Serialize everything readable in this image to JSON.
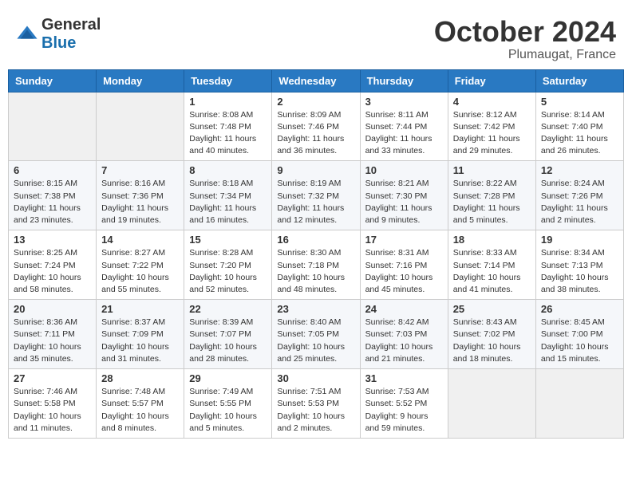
{
  "header": {
    "logo": {
      "general": "General",
      "blue": "Blue"
    },
    "title": "October 2024",
    "location": "Plumaugat, France"
  },
  "days_of_week": [
    "Sunday",
    "Monday",
    "Tuesday",
    "Wednesday",
    "Thursday",
    "Friday",
    "Saturday"
  ],
  "weeks": [
    [
      {
        "day": "",
        "sunrise": "",
        "sunset": "",
        "daylight": ""
      },
      {
        "day": "",
        "sunrise": "",
        "sunset": "",
        "daylight": ""
      },
      {
        "day": "1",
        "sunrise": "Sunrise: 8:08 AM",
        "sunset": "Sunset: 7:48 PM",
        "daylight": "Daylight: 11 hours and 40 minutes."
      },
      {
        "day": "2",
        "sunrise": "Sunrise: 8:09 AM",
        "sunset": "Sunset: 7:46 PM",
        "daylight": "Daylight: 11 hours and 36 minutes."
      },
      {
        "day": "3",
        "sunrise": "Sunrise: 8:11 AM",
        "sunset": "Sunset: 7:44 PM",
        "daylight": "Daylight: 11 hours and 33 minutes."
      },
      {
        "day": "4",
        "sunrise": "Sunrise: 8:12 AM",
        "sunset": "Sunset: 7:42 PM",
        "daylight": "Daylight: 11 hours and 29 minutes."
      },
      {
        "day": "5",
        "sunrise": "Sunrise: 8:14 AM",
        "sunset": "Sunset: 7:40 PM",
        "daylight": "Daylight: 11 hours and 26 minutes."
      }
    ],
    [
      {
        "day": "6",
        "sunrise": "Sunrise: 8:15 AM",
        "sunset": "Sunset: 7:38 PM",
        "daylight": "Daylight: 11 hours and 23 minutes."
      },
      {
        "day": "7",
        "sunrise": "Sunrise: 8:16 AM",
        "sunset": "Sunset: 7:36 PM",
        "daylight": "Daylight: 11 hours and 19 minutes."
      },
      {
        "day": "8",
        "sunrise": "Sunrise: 8:18 AM",
        "sunset": "Sunset: 7:34 PM",
        "daylight": "Daylight: 11 hours and 16 minutes."
      },
      {
        "day": "9",
        "sunrise": "Sunrise: 8:19 AM",
        "sunset": "Sunset: 7:32 PM",
        "daylight": "Daylight: 11 hours and 12 minutes."
      },
      {
        "day": "10",
        "sunrise": "Sunrise: 8:21 AM",
        "sunset": "Sunset: 7:30 PM",
        "daylight": "Daylight: 11 hours and 9 minutes."
      },
      {
        "day": "11",
        "sunrise": "Sunrise: 8:22 AM",
        "sunset": "Sunset: 7:28 PM",
        "daylight": "Daylight: 11 hours and 5 minutes."
      },
      {
        "day": "12",
        "sunrise": "Sunrise: 8:24 AM",
        "sunset": "Sunset: 7:26 PM",
        "daylight": "Daylight: 11 hours and 2 minutes."
      }
    ],
    [
      {
        "day": "13",
        "sunrise": "Sunrise: 8:25 AM",
        "sunset": "Sunset: 7:24 PM",
        "daylight": "Daylight: 10 hours and 58 minutes."
      },
      {
        "day": "14",
        "sunrise": "Sunrise: 8:27 AM",
        "sunset": "Sunset: 7:22 PM",
        "daylight": "Daylight: 10 hours and 55 minutes."
      },
      {
        "day": "15",
        "sunrise": "Sunrise: 8:28 AM",
        "sunset": "Sunset: 7:20 PM",
        "daylight": "Daylight: 10 hours and 52 minutes."
      },
      {
        "day": "16",
        "sunrise": "Sunrise: 8:30 AM",
        "sunset": "Sunset: 7:18 PM",
        "daylight": "Daylight: 10 hours and 48 minutes."
      },
      {
        "day": "17",
        "sunrise": "Sunrise: 8:31 AM",
        "sunset": "Sunset: 7:16 PM",
        "daylight": "Daylight: 10 hours and 45 minutes."
      },
      {
        "day": "18",
        "sunrise": "Sunrise: 8:33 AM",
        "sunset": "Sunset: 7:14 PM",
        "daylight": "Daylight: 10 hours and 41 minutes."
      },
      {
        "day": "19",
        "sunrise": "Sunrise: 8:34 AM",
        "sunset": "Sunset: 7:13 PM",
        "daylight": "Daylight: 10 hours and 38 minutes."
      }
    ],
    [
      {
        "day": "20",
        "sunrise": "Sunrise: 8:36 AM",
        "sunset": "Sunset: 7:11 PM",
        "daylight": "Daylight: 10 hours and 35 minutes."
      },
      {
        "day": "21",
        "sunrise": "Sunrise: 8:37 AM",
        "sunset": "Sunset: 7:09 PM",
        "daylight": "Daylight: 10 hours and 31 minutes."
      },
      {
        "day": "22",
        "sunrise": "Sunrise: 8:39 AM",
        "sunset": "Sunset: 7:07 PM",
        "daylight": "Daylight: 10 hours and 28 minutes."
      },
      {
        "day": "23",
        "sunrise": "Sunrise: 8:40 AM",
        "sunset": "Sunset: 7:05 PM",
        "daylight": "Daylight: 10 hours and 25 minutes."
      },
      {
        "day": "24",
        "sunrise": "Sunrise: 8:42 AM",
        "sunset": "Sunset: 7:03 PM",
        "daylight": "Daylight: 10 hours and 21 minutes."
      },
      {
        "day": "25",
        "sunrise": "Sunrise: 8:43 AM",
        "sunset": "Sunset: 7:02 PM",
        "daylight": "Daylight: 10 hours and 18 minutes."
      },
      {
        "day": "26",
        "sunrise": "Sunrise: 8:45 AM",
        "sunset": "Sunset: 7:00 PM",
        "daylight": "Daylight: 10 hours and 15 minutes."
      }
    ],
    [
      {
        "day": "27",
        "sunrise": "Sunrise: 7:46 AM",
        "sunset": "Sunset: 5:58 PM",
        "daylight": "Daylight: 10 hours and 11 minutes."
      },
      {
        "day": "28",
        "sunrise": "Sunrise: 7:48 AM",
        "sunset": "Sunset: 5:57 PM",
        "daylight": "Daylight: 10 hours and 8 minutes."
      },
      {
        "day": "29",
        "sunrise": "Sunrise: 7:49 AM",
        "sunset": "Sunset: 5:55 PM",
        "daylight": "Daylight: 10 hours and 5 minutes."
      },
      {
        "day": "30",
        "sunrise": "Sunrise: 7:51 AM",
        "sunset": "Sunset: 5:53 PM",
        "daylight": "Daylight: 10 hours and 2 minutes."
      },
      {
        "day": "31",
        "sunrise": "Sunrise: 7:53 AM",
        "sunset": "Sunset: 5:52 PM",
        "daylight": "Daylight: 9 hours and 59 minutes."
      },
      {
        "day": "",
        "sunrise": "",
        "sunset": "",
        "daylight": ""
      },
      {
        "day": "",
        "sunrise": "",
        "sunset": "",
        "daylight": ""
      }
    ]
  ]
}
